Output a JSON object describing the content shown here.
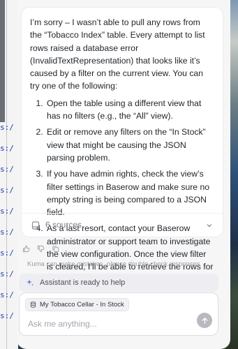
{
  "message": {
    "intro": "I’m sorry – I wasn’t able to pull any rows from the “Tobacco Index” table. Every attempt to list rows raised a database error (InvalidTextRepresentation) that looks like it’s caused by a filter on the current view. You can try one of the following:",
    "steps": [
      "Open the table using a different view that has no filters (e.g., the “All” view).",
      "Edit or remove any filters on the “In Stock” view that might be causing the JSON parsing problem.",
      "If you have admin rights, check the view’s filter settings in Baserow and make sure no empty string is being compared to a JSON field.",
      "As a last resort, contact your Baserow administrator or support team to investigate the view configuration. Once the view filter is cleared, I’ll be able to retrieve the rows for you."
    ],
    "sources_label": "6 sources"
  },
  "disclaimer": "Kuma can make mistakes, please double-check responses",
  "status": "Assistant is ready to help",
  "composer": {
    "context_chip": "My Tobacco Cellar - In Stock",
    "placeholder": "Ask me anything..."
  },
  "background": {
    "link_fragment": "s:/"
  }
}
